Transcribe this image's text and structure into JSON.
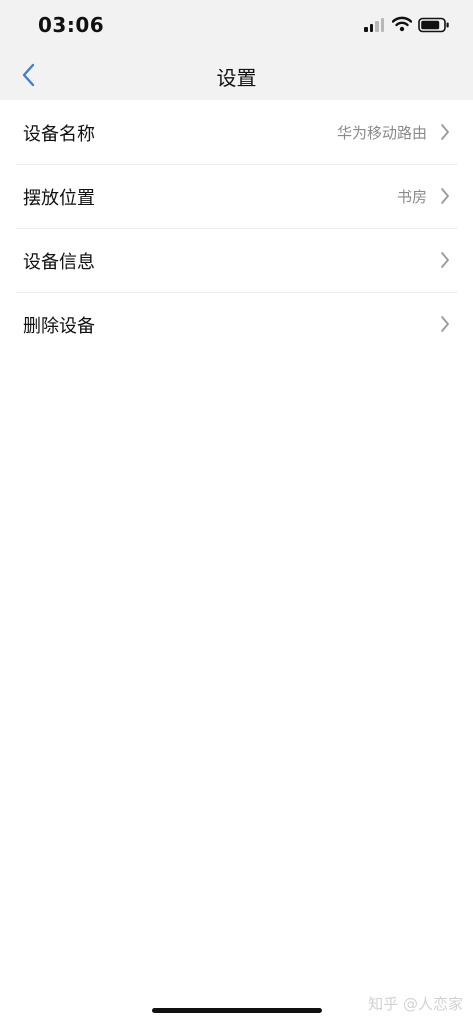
{
  "status_bar": {
    "time": "03:06",
    "signal_icon": "cellular-signal-icon",
    "wifi_icon": "wifi-icon",
    "battery_icon": "battery-icon"
  },
  "nav": {
    "back_icon": "chevron-left-icon",
    "title": "设置"
  },
  "settings": [
    {
      "label": "设备名称",
      "value": "华为移动路由"
    },
    {
      "label": "摆放位置",
      "value": "书房"
    },
    {
      "label": "设备信息",
      "value": ""
    },
    {
      "label": "删除设备",
      "value": ""
    }
  ],
  "watermark": "知乎 @人恋家",
  "colors": {
    "accent": "#3d7fd6",
    "bar_background": "#f2f2f2",
    "secondary_text": "#8a8a8a"
  }
}
